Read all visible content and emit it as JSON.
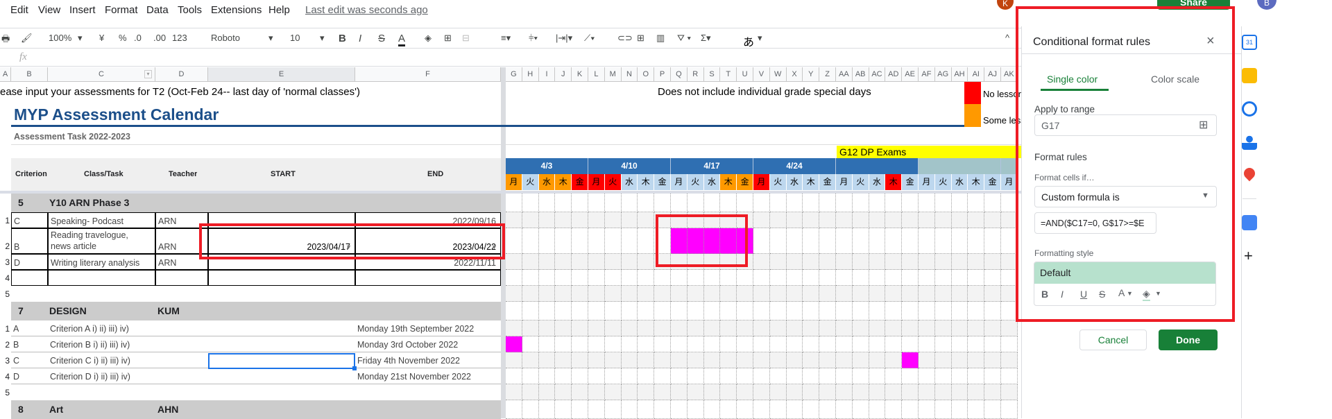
{
  "menu": {
    "items": [
      "Edit",
      "View",
      "Insert",
      "Format",
      "Data",
      "Tools",
      "Extensions",
      "Help"
    ],
    "last_edit": "Last edit was seconds ago"
  },
  "toolbar": {
    "zoom": "100%",
    "currency": "¥",
    "percent": "%",
    "dec_less": ".0",
    "dec_more": ".00",
    "format": "123",
    "font": "Roboto",
    "size": "10",
    "bold": "B",
    "italic": "I",
    "strike": "S",
    "text_color": "A",
    "ime": "あ"
  },
  "formula_bar": {
    "fx": "fx",
    "value": ""
  },
  "columns": [
    "A",
    "B",
    "C",
    "D",
    "E",
    "F"
  ],
  "cal_columns": [
    "G",
    "H",
    "I",
    "J",
    "K",
    "L",
    "M",
    "N",
    "O",
    "P",
    "Q",
    "R",
    "S",
    "T",
    "U",
    "V",
    "W",
    "X",
    "Y",
    "Z",
    "AA",
    "AB",
    "AC",
    "AD",
    "AE",
    "AF",
    "AG",
    "AH",
    "AI",
    "AJ",
    "AK"
  ],
  "sheet": {
    "instruction": "ease input your assessments for T2 (Oct-Feb 24-- last day of 'normal classes')",
    "title": "MYP Assessment Calendar",
    "subtitle": "Assessment Task 2022-2023",
    "note": "Does not include individual grade special days",
    "legend": [
      {
        "label": "No lesson",
        "color": "#ff0000"
      },
      {
        "label": "Some less",
        "color": "#ff9900"
      }
    ],
    "exams_label": "G12 DP Exams",
    "headers": {
      "criterion": "Criterion",
      "task": "Class/Task",
      "teacher": "Teacher",
      "start": "START",
      "end": "END"
    },
    "sections": [
      {
        "num": "5",
        "name": "Y10 ARN Phase 3",
        "teacher": "",
        "rows": [
          {
            "n": "1",
            "criterion": "C",
            "task": "Speaking- Podcast",
            "teacher": "ARN",
            "start": "",
            "end": "2022/09/16"
          },
          {
            "n": "2",
            "criterion": "B",
            "task": "Reading travelogue,",
            "task2": "news article",
            "teacher": "ARN",
            "start": "2023/04/17",
            "end": "2023/04/22"
          },
          {
            "n": "3",
            "criterion": "D",
            "task": "Writing literary analysis",
            "teacher": "ARN",
            "start": "",
            "end": "2022/11/11"
          },
          {
            "n": "4",
            "criterion": "",
            "task": "",
            "teacher": "",
            "start": "",
            "end": ""
          }
        ],
        "after": "5"
      },
      {
        "num": "7",
        "name": "DESIGN",
        "teacher": "KUM",
        "rows": [
          {
            "n": "1",
            "criterion": "A",
            "task": "Criterion A i) ii) iii) iv)",
            "teacher": "",
            "start": "",
            "end": "Monday 19th September 2022"
          },
          {
            "n": "2",
            "criterion": "B",
            "task": "Criterion B i) ii) iii) iv)",
            "teacher": "",
            "start": "",
            "end": "Monday 3rd October 2022"
          },
          {
            "n": "3",
            "criterion": "C",
            "task": "Criterion C  i) ii) iii) iv)",
            "teacher": "",
            "start": "",
            "end": "Friday 4th November 2022"
          },
          {
            "n": "4",
            "criterion": "D",
            "task": "Criterion D i) ii) iii) iv)",
            "teacher": "",
            "start": "",
            "end": "Monday 21st November 2022"
          }
        ],
        "after": "5"
      },
      {
        "num": "8",
        "name": "Art",
        "teacher": "AHN",
        "rows": []
      }
    ]
  },
  "calendar": {
    "weeks": [
      {
        "label": "4/3",
        "span": 5
      },
      {
        "label": "4/10",
        "span": 5
      },
      {
        "label": "4/17",
        "span": 5
      },
      {
        "label": "4/24",
        "span": 5
      },
      {
        "label": "",
        "span": 5
      },
      {
        "label": "",
        "span": 5,
        "color": "#a2c4c9"
      },
      {
        "label": "",
        "span": 1,
        "color": "#a2c4c9"
      }
    ],
    "days": [
      "月",
      "火",
      "水",
      "木",
      "金",
      "月",
      "火",
      "水",
      "木",
      "金",
      "月",
      "火",
      "水",
      "木",
      "金",
      "月",
      "火",
      "水",
      "木",
      "金",
      "月",
      "火",
      "水",
      "木",
      "金",
      "月",
      "火",
      "水",
      "木",
      "金",
      "月"
    ],
    "day_status": [
      "some",
      "",
      "some",
      "some",
      "none",
      "none",
      "none",
      "",
      "",
      "",
      "",
      "",
      "",
      "some",
      "some",
      "none",
      "",
      "",
      "",
      "",
      "",
      "",
      "",
      "none",
      "",
      "",
      "",
      "",
      "",
      "",
      ""
    ],
    "colors": {
      "none": "#ff0000",
      "some": "#ff9900",
      "normal": "#bdd7ee",
      "week": "#2f6fb2",
      "highlight": "#ff00ff",
      "exams": "#ffff00"
    },
    "highlighted": [
      {
        "row": "Y10-2",
        "cols": [
          "Q",
          "R",
          "S",
          "T",
          "U"
        ]
      },
      {
        "row": "DESIGN-2",
        "cols": [
          "G"
        ]
      },
      {
        "row": "DESIGN-3",
        "cols": [
          "AE"
        ]
      }
    ]
  },
  "panel": {
    "title": "Conditional format rules",
    "tabs": [
      "Single color",
      "Color scale"
    ],
    "active_tab": "Single color",
    "apply_label": "Apply to range",
    "range": "G17",
    "rules_label": "Format rules",
    "cells_if": "Format cells if…",
    "condition": "Custom formula is",
    "formula": "=AND($C17=0, G$17>=$E",
    "style_label": "Formatting style",
    "style_preview": "Default",
    "style_tools": [
      "B",
      "I",
      "U",
      "S",
      "A"
    ],
    "cancel": "Cancel",
    "done": "Done"
  },
  "header_right": {
    "avatar": "K",
    "share": "Share",
    "account": "B"
  }
}
